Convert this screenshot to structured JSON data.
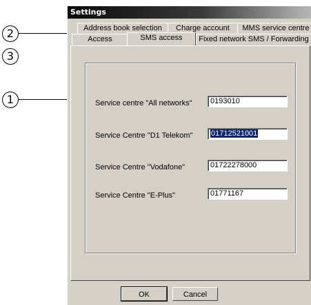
{
  "window": {
    "title": "Settings"
  },
  "callouts": [
    "2",
    "3",
    "1"
  ],
  "tabs": {
    "row_back": [
      "Address book selection",
      "Charge account",
      "MMS service centre"
    ],
    "row_front": [
      "Access",
      "SMS access",
      "Fixed network SMS / Forwarding"
    ],
    "active": "SMS access"
  },
  "fields": [
    {
      "label": "Service centre \"All networks\"",
      "value": "0193010"
    },
    {
      "label": "Service Centre \"D1 Telekom\"",
      "value": "01712521001",
      "selected": true
    },
    {
      "label": "Service Centre \"Vodafone\"",
      "value": "01722278000"
    },
    {
      "label": "Service Centre \"E-Plus\"",
      "value": "01771167"
    }
  ],
  "buttons": {
    "ok": "OK",
    "cancel": "Cancel"
  }
}
